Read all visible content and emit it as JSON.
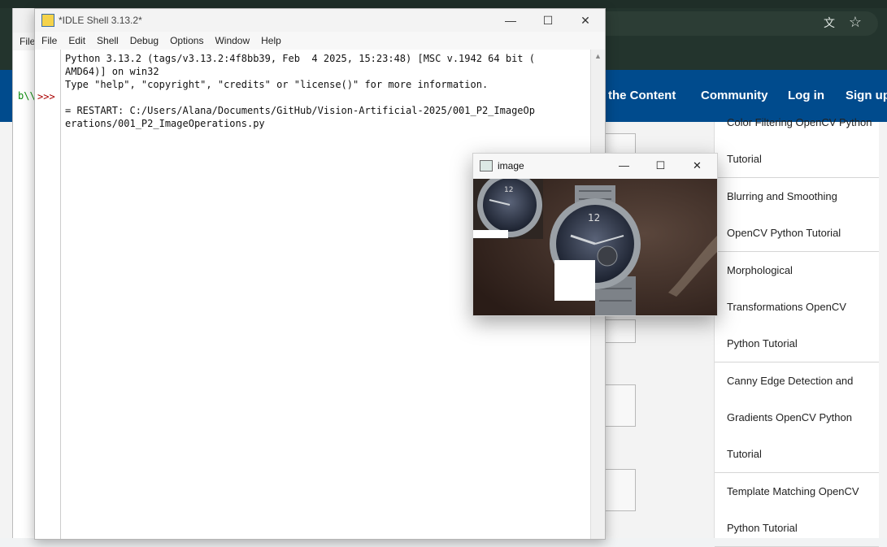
{
  "browser": {
    "nav_items": [
      "rt the Content",
      "Community",
      "Log in",
      "Sign up"
    ],
    "sidebar_items": [
      [
        "Color Filtering OpenCV Python",
        "Tutorial"
      ],
      [
        "Blurring and Smoothing",
        "OpenCV Python Tutorial"
      ],
      [
        "Morphological",
        "Transformations OpenCV",
        "Python Tutorial"
      ],
      [
        "Canny Edge Detection and",
        "Gradients OpenCV Python",
        "Tutorial"
      ],
      [
        "Template Matching OpenCV",
        "Python Tutorial"
      ]
    ],
    "icons": [
      "translate-icon",
      "star-icon"
    ],
    "colors": {
      "nav_bg": "#004b8d",
      "top_bg": "#23342d"
    }
  },
  "idle_back": {
    "menu_label": "File",
    "prompt_prefix": "b\\\\",
    "prompt": ">>>"
  },
  "idle": {
    "title": "*IDLE Shell 3.13.2*",
    "menu": [
      "File",
      "Edit",
      "Shell",
      "Debug",
      "Options",
      "Window",
      "Help"
    ],
    "prompt": ">>>",
    "output": "Python 3.13.2 (tags/v3.13.2:4f8bb39, Feb  4 2025, 15:23:48) [MSC v.1942 64 bit (\nAMD64)] on win32\nType \"help\", \"copyright\", \"credits\" or \"license()\" for more information.\n\n= RESTART: C:/Users/Alana/Documents/GitHub/Vision-Artificial-2025/001_P2_ImageOp\nerations/001_P2_ImageOperations.py",
    "minimize": "—",
    "maximize": "☐",
    "close": "✕"
  },
  "cv_window": {
    "title": "image",
    "minimize": "—",
    "maximize": "☐",
    "close": "✕"
  }
}
